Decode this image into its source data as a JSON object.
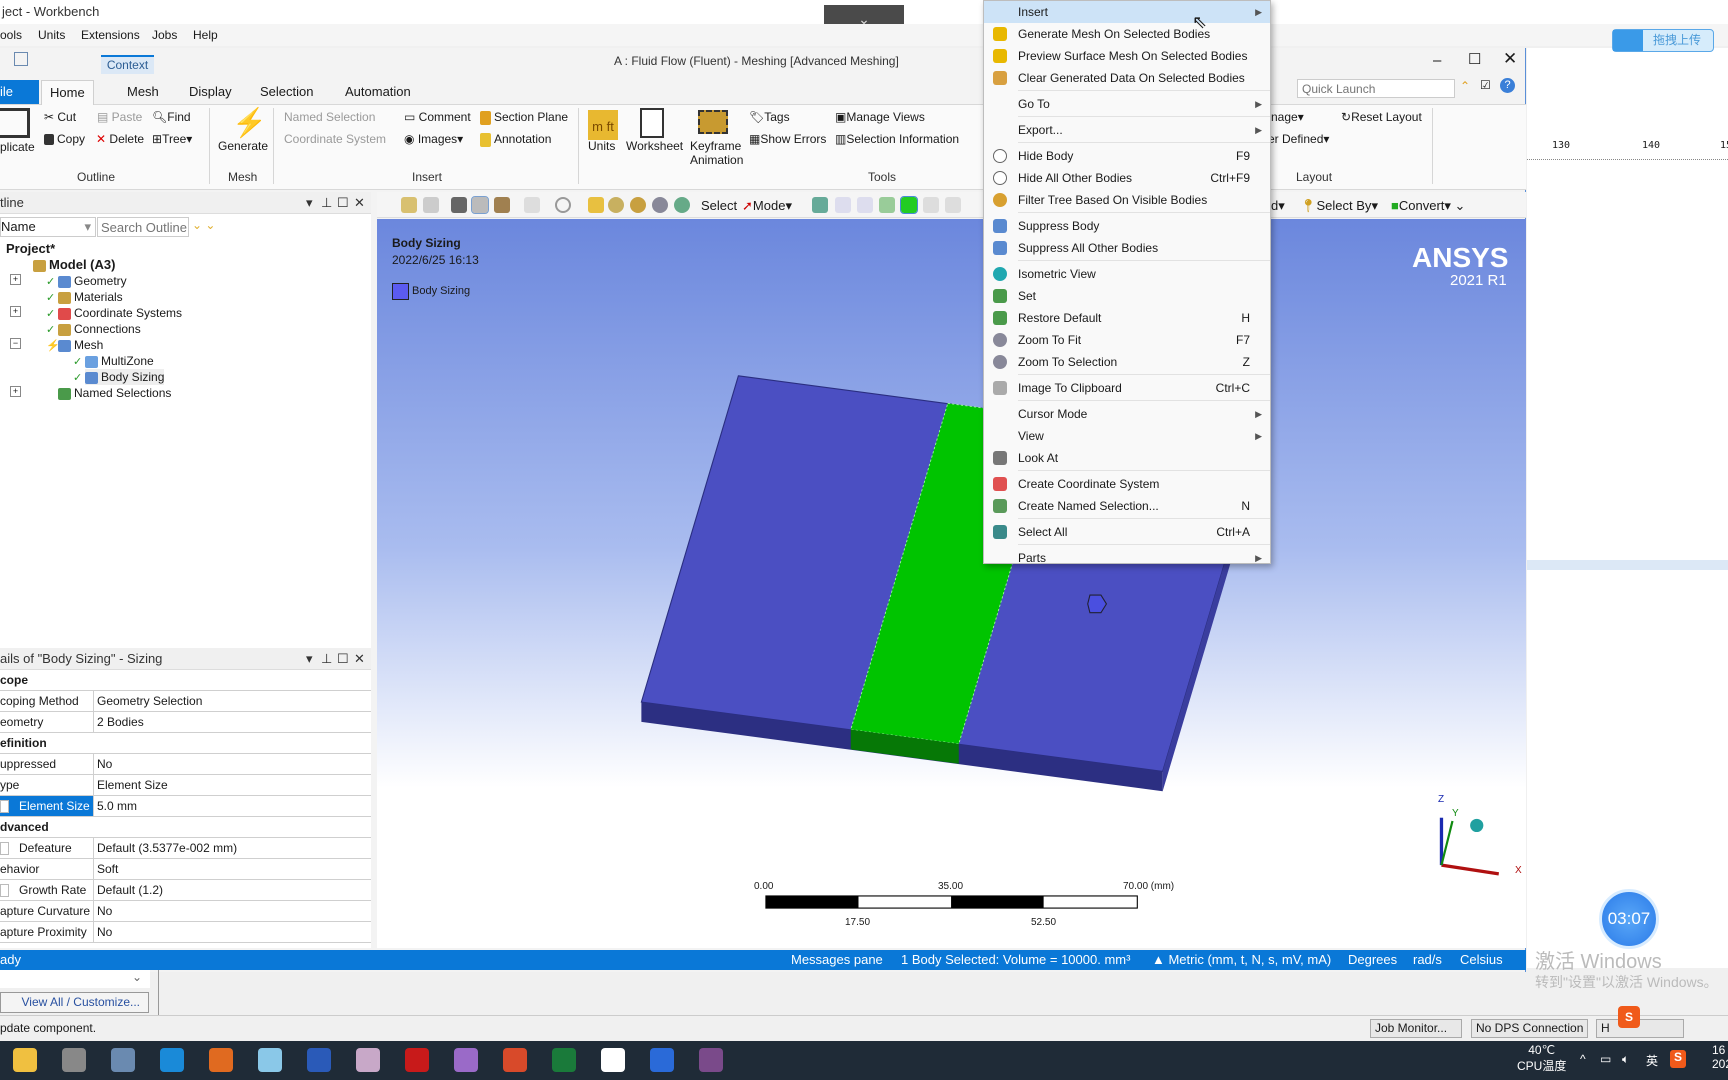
{
  "window": {
    "outer_title": "ject - Workbench",
    "meshing_title": "A : Fluid Flow (Fluent) - Meshing [Advanced Meshing]",
    "context_tab": "Context"
  },
  "menubar": [
    "ools",
    "Units",
    "Extensions",
    "Jobs",
    "Help"
  ],
  "tabs": [
    {
      "label": "ile",
      "active": false,
      "file": true
    },
    {
      "label": "Home",
      "active": true
    },
    {
      "label": "Mesh"
    },
    {
      "label": "Display"
    },
    {
      "label": "Selection"
    },
    {
      "label": "Automation"
    }
  ],
  "ribbon": {
    "outline": {
      "label": "Outline",
      "duplicate": "plicate",
      "cut": "Cut",
      "paste": "Paste",
      "find": "Find",
      "copy": "Copy",
      "delete": "Delete",
      "tree": "Tree"
    },
    "mesh": {
      "label": "Mesh",
      "generate": "Generate"
    },
    "insert": {
      "label": "Insert",
      "named_selection": "Named Selection",
      "coordinate_system": "Coordinate System",
      "comment": "Comment",
      "images": "Images",
      "section_plane": "Section Plane",
      "annotation": "Annotation"
    },
    "tools": {
      "label": "Tools",
      "units": "Units",
      "worksheet": "Worksheet",
      "keyframe": "Keyframe",
      "animation": "Animation",
      "tags": "Tags",
      "show_errors": "Show Errors",
      "manage_views": "Manage Views",
      "selection_information": "Selection Information"
    },
    "layout": {
      "label": "Layout",
      "image": "nage",
      "user_defined": "er Defined",
      "reset_layout": "Reset Layout"
    },
    "quick_launch_placeholder": "Quick Launch"
  },
  "toolbar": {
    "select": "Select",
    "mode": "Mode",
    "d": "d",
    "select_by": "Select By",
    "convert": "Convert"
  },
  "outline": {
    "title": "tline",
    "filter": "Name",
    "search_placeholder": "Search Outline",
    "tree": [
      {
        "label": "Project*",
        "level": 0,
        "bold": true
      },
      {
        "label": "Model (A3)",
        "level": 1,
        "bold": true
      },
      {
        "label": "Geometry",
        "level": 2
      },
      {
        "label": "Materials",
        "level": 2
      },
      {
        "label": "Coordinate Systems",
        "level": 2
      },
      {
        "label": "Connections",
        "level": 2
      },
      {
        "label": "Mesh",
        "level": 2
      },
      {
        "label": "MultiZone",
        "level": 3
      },
      {
        "label": "Body Sizing",
        "level": 3,
        "selected": true
      },
      {
        "label": "Named Selections",
        "level": 2
      }
    ]
  },
  "details": {
    "title": "ails of \"Body Sizing\" - Sizing",
    "rows": [
      {
        "k": "cope",
        "header": true
      },
      {
        "k": "coping Method",
        "v": "Geometry Selection"
      },
      {
        "k": "eometry",
        "v": "2 Bodies"
      },
      {
        "k": "efinition",
        "header": true
      },
      {
        "k": "uppressed",
        "v": "No"
      },
      {
        "k": "ype",
        "v": "Element Size"
      },
      {
        "k": "Element Size",
        "v": "5.0 mm",
        "highlight": true,
        "checkbox": true
      },
      {
        "k": "dvanced",
        "header": true
      },
      {
        "k": "Defeature Size",
        "v": "Default (3.5377e-002 mm)",
        "checkbox": true
      },
      {
        "k": "ehavior",
        "v": "Soft"
      },
      {
        "k": "Growth Rate",
        "v": "Default (1.2)",
        "checkbox": true
      },
      {
        "k": "apture Curvature",
        "v": "No"
      },
      {
        "k": "apture Proximity",
        "v": "No"
      }
    ]
  },
  "viewport": {
    "title": "Body Sizing",
    "timestamp": "2022/6/25 16:13",
    "legend": "Body Sizing",
    "legend_color": "#5b5bf0",
    "logo": "ANSYS",
    "version": "2021 R1",
    "scale": {
      "top": [
        "0.00",
        "35.00",
        "70.00 (mm)"
      ],
      "bottom": [
        "17.50",
        "52.50"
      ]
    },
    "axes": {
      "x": "X",
      "y": "Y",
      "z": "Z"
    },
    "colors": {
      "body": "#4b4fc2",
      "selected_body": "#00c400"
    }
  },
  "statusbar": {
    "ready": "ady",
    "messages": "Messages pane",
    "selection": "1 Body Selected: Volume = 10000. mm³",
    "units": "▲ Metric (mm, t, N, s, mV, mA)",
    "angle": "Degrees",
    "angular_velocity": "rad/s",
    "temperature": "Celsius"
  },
  "context_menu": [
    {
      "label": "Insert",
      "submenu": true,
      "highlight": true
    },
    {
      "label": "Generate Mesh On Selected Bodies",
      "icon": "lightning-icon"
    },
    {
      "label": "Preview Surface Mesh On Selected Bodies",
      "icon": "lightning-icon"
    },
    {
      "label": "Clear Generated Data On Selected Bodies",
      "icon": "eraser-icon",
      "sep": true
    },
    {
      "label": "Go To",
      "submenu": true,
      "sep": true
    },
    {
      "label": "Export...",
      "submenu": true,
      "sep": true
    },
    {
      "label": "Hide Body",
      "shortcut": "F9",
      "icon": "bulb-icon"
    },
    {
      "label": "Hide All Other Bodies",
      "shortcut": "Ctrl+F9",
      "icon": "bulb-icon"
    },
    {
      "label": "Filter Tree Based On Visible Bodies",
      "icon": "bulb-on-icon",
      "sep": true
    },
    {
      "label": "Suppress Body",
      "icon": "suppress-icon"
    },
    {
      "label": "Suppress All Other Bodies",
      "icon": "suppress-icon",
      "sep": true
    },
    {
      "label": "Isometric View",
      "icon": "sphere-icon"
    },
    {
      "label": "Set",
      "icon": "axes-icon"
    },
    {
      "label": "Restore Default",
      "shortcut": "H",
      "icon": "axes-icon"
    },
    {
      "label": "Zoom To Fit",
      "shortcut": "F7",
      "icon": "zoom-icon"
    },
    {
      "label": "Zoom To Selection",
      "shortcut": "Z",
      "icon": "zoom-icon",
      "sep": true
    },
    {
      "label": "Image To Clipboard",
      "shortcut": "Ctrl+C",
      "icon": "camera-icon",
      "sep": true
    },
    {
      "label": "Cursor Mode",
      "submenu": true
    },
    {
      "label": "View",
      "submenu": true
    },
    {
      "label": "Look At",
      "icon": "look-at-icon",
      "sep": true
    },
    {
      "label": "Create Coordinate System",
      "icon": "coordinate-icon"
    },
    {
      "label": "Create Named Selection...",
      "shortcut": "N",
      "icon": "named-selection-icon",
      "sep": true
    },
    {
      "label": "Select All",
      "shortcut": "Ctrl+A",
      "icon": "select-all-icon",
      "sep": true
    },
    {
      "label": "Parts",
      "submenu": true
    }
  ],
  "bottom": {
    "view_all": "View All / Customize...",
    "message": "pdate component.",
    "tray_buttons": [
      "Job Monitor...",
      "No DPS Connection",
      "H"
    ]
  },
  "right_panel": {
    "upload": "拖拽上传",
    "ruler": [
      "130",
      "140",
      "150"
    ],
    "timer": "03:07",
    "activate_title": "激活 Windows",
    "activate_sub": "转到\"设置\"以激活 Windows。"
  },
  "taskbar": {
    "apps": [
      "file-explorer-icon",
      "workbench-icon",
      "app-icon",
      "edge-icon",
      "matlab-icon",
      "notepad-icon",
      "word-icon",
      "snip-icon",
      "acrobat-icon",
      "winrar-icon",
      "powerpoint-icon",
      "excel-icon",
      "baidu-netdisk-icon",
      "fluent-icon",
      "meshing-icon"
    ],
    "temp": "40℃",
    "temp_label": "CPU温度",
    "ime": "英",
    "clock": "16",
    "date": "202"
  }
}
